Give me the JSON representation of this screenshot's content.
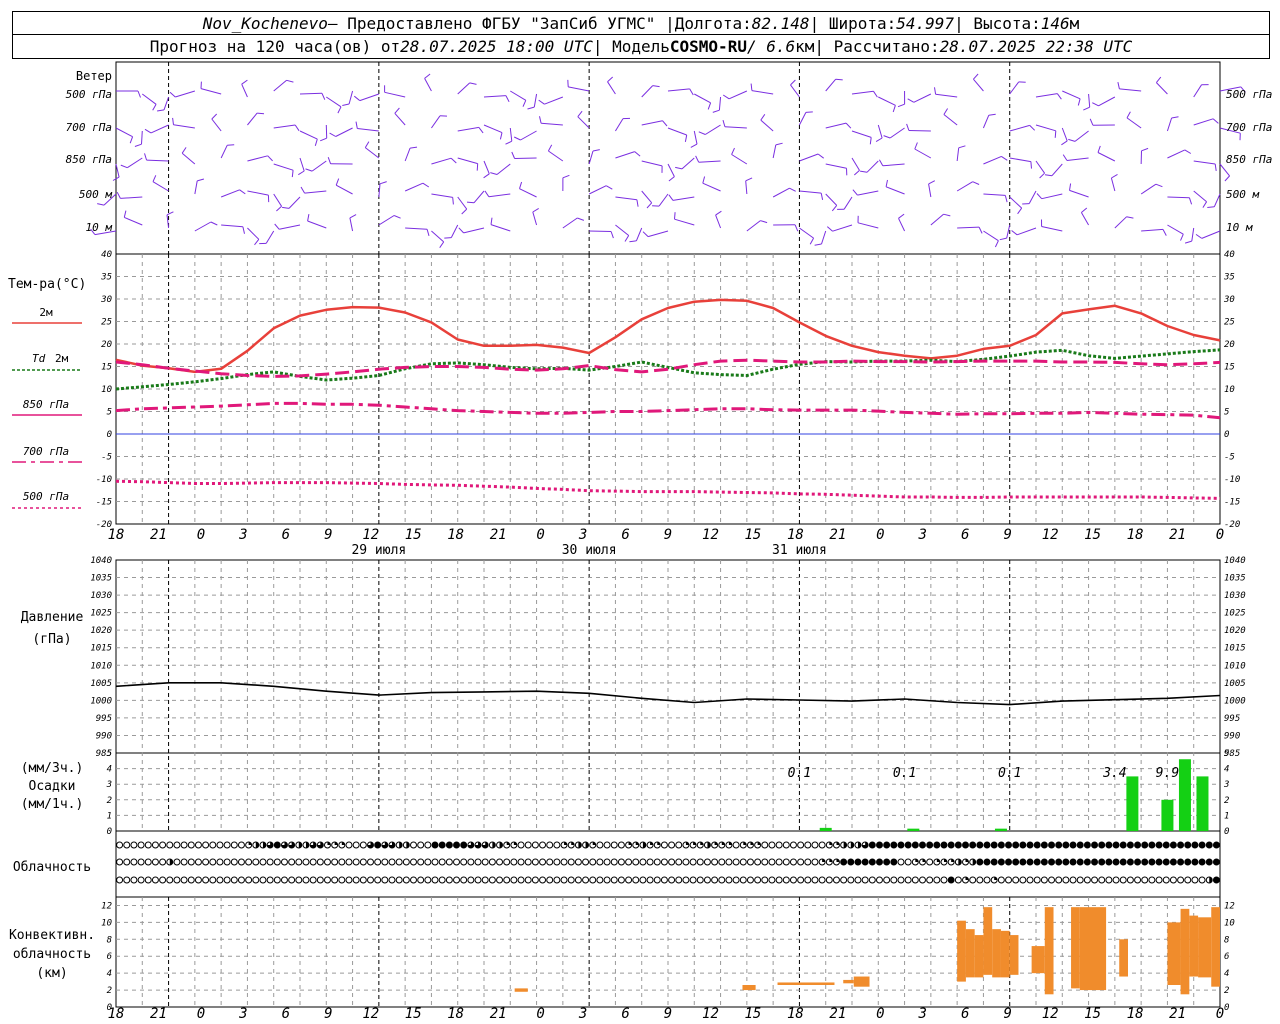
{
  "header": {
    "station": "Nov_Kochenevo",
    "provider": " – Предоставлено ФГБУ \"ЗапСиб УГМС\" | ",
    "lon_label": "Долгота: ",
    "lon": "82.148",
    "lat_sep": " | Широта: ",
    "lat": "54.997",
    "alt_sep": " | Высота: ",
    "alt": "146",
    "alt_unit": "м",
    "forecast_label": "Прогноз на 120 часа(ов) от ",
    "forecast_time": "28.07.2025 18:00 UTC",
    "model_label": "  | Модель ",
    "model": "COSMO-RU",
    "resolution": " / 6.6",
    "res_unit": "км",
    "calc_label": " | Рассчитано: ",
    "calc_time": "28.07.2025 22:38 UTC"
  },
  "panel_labels": {
    "wind_title": "Ветер",
    "wind_levels": [
      "500 гПа",
      "700 гПа",
      "850 гПа",
      "500 м",
      "10  м"
    ],
    "temp_title": "Тем-ра(°С)",
    "t2m": "2м",
    "td": "Td",
    "td_2m": "2м",
    "t850": "850 гПа",
    "t700": "700 гПа",
    "t500": "500 гПа",
    "pressure_title": "Давление",
    "pressure_unit": "(гПа)",
    "precip_unit3": "(мм/3ч.)",
    "precip_title": "Осадки",
    "precip_unit1": "(мм/1ч.)",
    "cloud_title": "Облачность",
    "conv_title1": "Конвективн.",
    "conv_title2": "облачность",
    "conv_unit": "(км)"
  },
  "colors": {
    "t2m": "#e8403a",
    "td2m": "#197a19",
    "t850": "#e0187a",
    "t700": "#e0187a",
    "t500": "#e0187a",
    "wind": "#7a2ee0",
    "zero_line": "#3040e0",
    "pressure": "#000000",
    "precip": "#14d014",
    "convective": "#f08c2c"
  },
  "time_axis": {
    "hour_labels": [
      "18",
      "21",
      "0",
      "3",
      "6",
      "9",
      "12",
      "15",
      "18",
      "21",
      "0",
      "3",
      "6",
      "9",
      "12",
      "15",
      "18",
      "21",
      "0",
      "3",
      "6",
      "9",
      "12",
      "15",
      "18",
      "21",
      "0"
    ],
    "day_labels": [
      "29 июля",
      "30 июля",
      "31 июля"
    ]
  },
  "chart_data": [
    {
      "type": "line",
      "title": "Тем-ра(°С)",
      "x_hours": [
        0,
        3,
        6,
        9,
        12,
        15,
        18,
        21,
        24,
        27,
        30,
        33,
        36,
        39,
        42,
        45,
        48,
        51,
        54,
        57,
        60,
        63,
        66,
        69,
        72,
        75,
        78,
        81,
        84,
        87,
        90,
        93,
        96,
        99,
        102,
        105,
        108,
        111,
        114,
        117,
        120,
        123,
        126
      ],
      "ylim": [
        -20,
        40
      ],
      "yticks": [
        -20,
        -15,
        -10,
        -5,
        0,
        5,
        10,
        15,
        20,
        25,
        30,
        35,
        40
      ],
      "series": [
        {
          "name": "2м",
          "values": [
            16.5,
            15.2,
            14.6,
            13.8,
            14.5,
            18.5,
            23.5,
            26.3,
            27.6,
            28.2,
            28.1,
            27.0,
            24.8,
            21.0,
            19.6,
            19.6,
            19.8,
            19.2,
            18.0,
            21.5,
            25.5,
            28.0,
            29.4,
            29.8,
            29.6,
            28.0,
            24.8,
            21.8,
            19.6,
            18.2,
            17.4,
            16.8,
            17.4,
            18.9,
            19.6,
            22.0,
            26.8,
            27.7,
            28.5,
            26.8,
            24.0,
            22.0,
            20.8
          ]
        },
        {
          "name": "Td 2м",
          "values": [
            10.0,
            10.5,
            11.0,
            11.6,
            12.3,
            13.2,
            13.8,
            12.8,
            12.0,
            12.4,
            13.0,
            14.5,
            15.6,
            15.8,
            15.4,
            14.8,
            14.5,
            14.6,
            14.2,
            15.0,
            16.0,
            14.8,
            13.6,
            13.2,
            13.0,
            14.4,
            15.5,
            16.1,
            16.0,
            16.2,
            16.2,
            16.4,
            16.1,
            16.6,
            17.3,
            18.2,
            18.6,
            17.4,
            16.8,
            17.3,
            17.8,
            18.3,
            18.7
          ]
        },
        {
          "name": "850 гПа",
          "values": [
            16.0,
            15.4,
            14.6,
            14.0,
            13.4,
            13.0,
            12.8,
            12.9,
            13.3,
            13.8,
            14.4,
            14.8,
            15.0,
            15.0,
            14.8,
            14.4,
            14.2,
            14.5,
            15.2,
            14.3,
            13.8,
            14.4,
            15.4,
            16.2,
            16.4,
            16.2,
            16.0,
            16.0,
            16.2,
            16.1,
            16.1,
            16.0,
            16.1,
            16.2,
            16.2,
            16.2,
            16.0,
            16.0,
            15.9,
            15.6,
            15.4,
            15.6,
            15.9
          ]
        },
        {
          "name": "700 гПа",
          "values": [
            5.2,
            5.6,
            5.8,
            6.0,
            6.2,
            6.5,
            6.8,
            6.8,
            6.6,
            6.6,
            6.4,
            6.0,
            5.6,
            5.2,
            5.0,
            4.8,
            4.6,
            4.6,
            4.8,
            5.0,
            5.0,
            5.2,
            5.4,
            5.6,
            5.6,
            5.4,
            5.3,
            5.3,
            5.3,
            5.1,
            4.8,
            4.6,
            4.4,
            4.5,
            4.5,
            4.6,
            4.6,
            4.8,
            4.6,
            4.4,
            4.3,
            4.2,
            3.6
          ]
        },
        {
          "name": "500 гПа",
          "values": [
            -10.5,
            -10.6,
            -10.8,
            -11.0,
            -11.0,
            -10.9,
            -10.8,
            -10.8,
            -10.8,
            -10.9,
            -11.0,
            -11.2,
            -11.3,
            -11.4,
            -11.6,
            -11.8,
            -12.1,
            -12.3,
            -12.6,
            -12.7,
            -12.8,
            -12.8,
            -12.8,
            -12.9,
            -13.0,
            -13.1,
            -13.3,
            -13.4,
            -13.6,
            -13.8,
            -14.0,
            -14.0,
            -14.1,
            -14.1,
            -14.0,
            -14.0,
            -14.0,
            -14.0,
            -14.0,
            -14.0,
            -14.1,
            -14.2,
            -14.3
          ]
        }
      ]
    },
    {
      "type": "line",
      "title": "Давление",
      "ylabel": "(гПа)",
      "x_hours": [
        0,
        6,
        12,
        18,
        24,
        30,
        36,
        42,
        48,
        54,
        60,
        66,
        72,
        78,
        84,
        90,
        96,
        102,
        108,
        114,
        120,
        126
      ],
      "ylim": [
        985,
        1040
      ],
      "yticks": [
        985,
        990,
        995,
        1000,
        1005,
        1010,
        1015,
        1020,
        1025,
        1030,
        1035,
        1040
      ],
      "series": [
        {
          "name": "Давление",
          "values": [
            1004.0,
            1005.0,
            1005.0,
            1004.0,
            1002.6,
            1001.5,
            1002.2,
            1002.4,
            1002.6,
            1002.0,
            1000.6,
            999.4,
            1000.4,
            1000.1,
            999.8,
            1000.4,
            999.4,
            998.8,
            999.8,
            1000.2,
            1000.6,
            1001.4
          ]
        }
      ]
    },
    {
      "type": "bar",
      "title": "Осадки",
      "ylabel": "(мм/3ч.) (мм/1ч.)",
      "ylim": [
        0,
        5
      ],
      "yticks": [
        0,
        1,
        2,
        3,
        4,
        5
      ],
      "annotations": [
        {
          "x_hour": 78,
          "text": "0.1"
        },
        {
          "x_hour": 90,
          "text": "0.1"
        },
        {
          "x_hour": 102,
          "text": "0.1"
        },
        {
          "x_hour": 114,
          "text": "3.4"
        },
        {
          "x_hour": 120,
          "text": "9.9"
        }
      ],
      "bars": [
        {
          "x_hour": 81,
          "value": 0.2
        },
        {
          "x_hour": 91,
          "value": 0.15
        },
        {
          "x_hour": 101,
          "value": 0.15
        },
        {
          "x_hour": 116,
          "value": 3.5
        },
        {
          "x_hour": 120,
          "value": 2.0
        },
        {
          "x_hour": 122,
          "value": 4.6
        },
        {
          "x_hour": 124,
          "value": 3.5
        }
      ]
    },
    {
      "type": "heatmap",
      "title": "Облачность",
      "levels": 3,
      "rows": [
        [
          0,
          0,
          0,
          0,
          0,
          0,
          0,
          0,
          0,
          0,
          0,
          0,
          0,
          0,
          0,
          0,
          0,
          0,
          1,
          2,
          2,
          3,
          4,
          3,
          3,
          2,
          2,
          3,
          3,
          1,
          1,
          1,
          0,
          0,
          0,
          3,
          4,
          3,
          3,
          2,
          2,
          0,
          0,
          0,
          4,
          4,
          4,
          4,
          4,
          3,
          3,
          3,
          2,
          2,
          1,
          1,
          0,
          0,
          0,
          0,
          0,
          0,
          1,
          1,
          2,
          2,
          1,
          0,
          0,
          0,
          0,
          1,
          1,
          2,
          1,
          1,
          0,
          0,
          0,
          1,
          1,
          1,
          2,
          1,
          1,
          1,
          0,
          1,
          1,
          1,
          0,
          0,
          0,
          0,
          0,
          0,
          0,
          0,
          0,
          1,
          1,
          2,
          2,
          2,
          3,
          4,
          4,
          4,
          4,
          4,
          4,
          4,
          4,
          4,
          4,
          4,
          4,
          4,
          4,
          4,
          4,
          4,
          4,
          4,
          4,
          4,
          4,
          4,
          4,
          4,
          4,
          4,
          4,
          4,
          4,
          4,
          4,
          4,
          4,
          4,
          4,
          4,
          4,
          4,
          4,
          4,
          4,
          4,
          4,
          4,
          4,
          4,
          4,
          4
        ],
        [
          0,
          0,
          0,
          0,
          0,
          0,
          0,
          2,
          0,
          0,
          0,
          0,
          0,
          0,
          0,
          0,
          0,
          0,
          0,
          0,
          0,
          0,
          0,
          0,
          0,
          0,
          0,
          0,
          0,
          0,
          0,
          0,
          0,
          0,
          0,
          0,
          0,
          0,
          0,
          0,
          0,
          0,
          0,
          0,
          0,
          0,
          0,
          0,
          0,
          0,
          0,
          0,
          0,
          0,
          0,
          0,
          0,
          0,
          0,
          0,
          0,
          0,
          0,
          0,
          0,
          0,
          0,
          0,
          0,
          0,
          0,
          0,
          0,
          0,
          0,
          0,
          0,
          0,
          0,
          0,
          0,
          0,
          0,
          0,
          0,
          0,
          0,
          0,
          0,
          0,
          0,
          0,
          0,
          0,
          0,
          0,
          0,
          0,
          1,
          1,
          1,
          4,
          4,
          4,
          4,
          4,
          4,
          4,
          4,
          0,
          0,
          1,
          1,
          0,
          1,
          1,
          1,
          2,
          1,
          2,
          4,
          4,
          4,
          4,
          4,
          4,
          4,
          4,
          4,
          4,
          4,
          4,
          4,
          4,
          4,
          4,
          4,
          4,
          4,
          4,
          4,
          4,
          4,
          4,
          4,
          4,
          4,
          4,
          4,
          4,
          4,
          4,
          4,
          4
        ],
        [
          0,
          0,
          0,
          0,
          0,
          0,
          0,
          0,
          0,
          0,
          0,
          0,
          0,
          0,
          0,
          0,
          0,
          0,
          0,
          0,
          0,
          0,
          0,
          0,
          0,
          0,
          0,
          0,
          0,
          0,
          0,
          0,
          0,
          0,
          0,
          0,
          0,
          0,
          0,
          0,
          0,
          0,
          0,
          0,
          0,
          0,
          0,
          0,
          0,
          0,
          0,
          0,
          0,
          0,
          0,
          0,
          0,
          0,
          0,
          0,
          0,
          0,
          0,
          0,
          0,
          0,
          0,
          0,
          0,
          0,
          0,
          0,
          0,
          0,
          0,
          0,
          0,
          0,
          0,
          0,
          0,
          0,
          0,
          0,
          0,
          0,
          0,
          0,
          0,
          0,
          0,
          0,
          0,
          0,
          0,
          0,
          0,
          0,
          0,
          0,
          0,
          0,
          0,
          0,
          0,
          0,
          0,
          0,
          0,
          0,
          0,
          0,
          0,
          0,
          0,
          0,
          4,
          0,
          1,
          0,
          0,
          0,
          1,
          0,
          0,
          0,
          0,
          0,
          0,
          0,
          0,
          0,
          0,
          0,
          0,
          0,
          0,
          0,
          0,
          0,
          0,
          0,
          0,
          0,
          0,
          0,
          0,
          0,
          0,
          0,
          0,
          0,
          2,
          4
        ]
      ]
    },
    {
      "type": "bar",
      "title": "Конвективн. облачность",
      "ylabel": "(км)",
      "ylim": [
        0,
        13
      ],
      "yticks": [
        0,
        2,
        4,
        6,
        8,
        10,
        12
      ],
      "bars": [
        {
          "x_start": 45.5,
          "x_end": 47,
          "base": 1.8,
          "top": 2.2
        },
        {
          "x_start": 71.5,
          "x_end": 73,
          "base": 2.0,
          "top": 2.6
        },
        {
          "x_start": 75.5,
          "x_end": 82,
          "base": 2.6,
          "top": 2.9
        },
        {
          "x_start": 83.0,
          "x_end": 84.2,
          "base": 2.8,
          "top": 3.2
        },
        {
          "x_start": 84.2,
          "x_end": 86.0,
          "base": 2.4,
          "top": 3.6
        },
        {
          "x_start": 96.0,
          "x_end": 97.0,
          "base": 3.0,
          "top": 10.2
        },
        {
          "x_start": 97.0,
          "x_end": 98.0,
          "base": 3.5,
          "top": 9.2
        },
        {
          "x_start": 98.0,
          "x_end": 99.0,
          "base": 3.5,
          "top": 8.5
        },
        {
          "x_start": 99.0,
          "x_end": 100.0,
          "base": 3.8,
          "top": 11.8
        },
        {
          "x_start": 100.0,
          "x_end": 101.0,
          "base": 3.5,
          "top": 9.2
        },
        {
          "x_start": 101.0,
          "x_end": 102.0,
          "base": 3.5,
          "top": 9.0
        },
        {
          "x_start": 102.0,
          "x_end": 103.0,
          "base": 3.8,
          "top": 8.5
        },
        {
          "x_start": 104.5,
          "x_end": 106.0,
          "base": 4.0,
          "top": 7.2
        },
        {
          "x_start": 106.0,
          "x_end": 107.0,
          "base": 1.5,
          "top": 11.8
        },
        {
          "x_start": 109.0,
          "x_end": 110.0,
          "base": 2.2,
          "top": 11.8
        },
        {
          "x_start": 110.0,
          "x_end": 113.0,
          "base": 2.0,
          "top": 11.8
        },
        {
          "x_start": 114.5,
          "x_end": 115.5,
          "base": 3.6,
          "top": 8.0
        },
        {
          "x_start": 120.0,
          "x_end": 121.5,
          "base": 2.6,
          "top": 10.0
        },
        {
          "x_start": 121.5,
          "x_end": 122.5,
          "base": 1.5,
          "top": 11.6
        },
        {
          "x_start": 122.5,
          "x_end": 123.5,
          "base": 3.6,
          "top": 10.8
        },
        {
          "x_start": 123.5,
          "x_end": 125.0,
          "base": 3.5,
          "top": 10.6
        },
        {
          "x_start": 125.0,
          "x_end": 126.0,
          "base": 2.4,
          "top": 11.8
        }
      ]
    }
  ]
}
